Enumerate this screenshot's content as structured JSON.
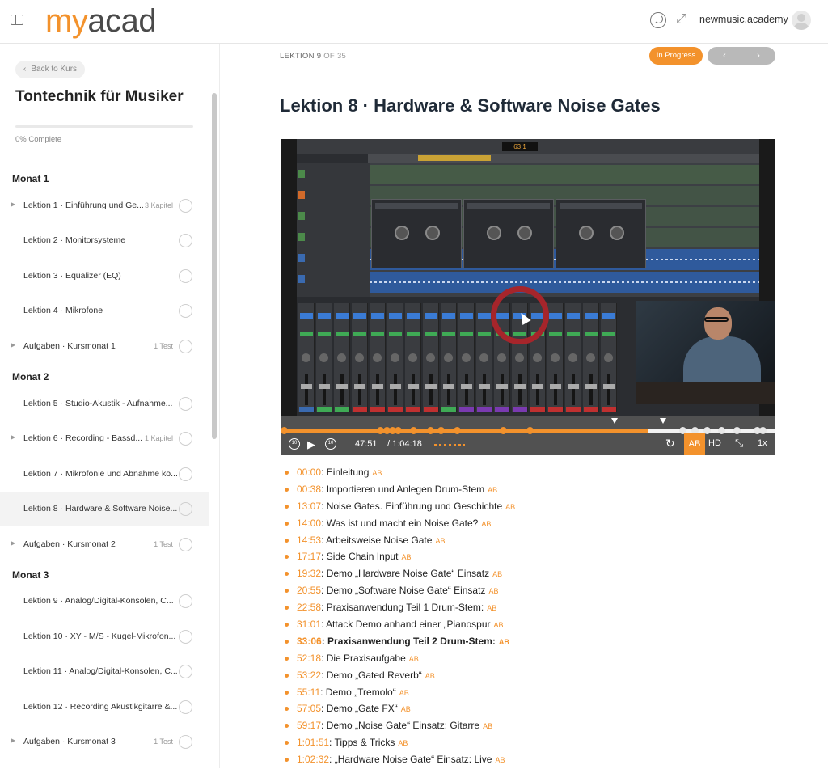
{
  "header": {
    "logo_my": "my",
    "logo_acad": "acad",
    "account": "newmusic.academy"
  },
  "sidebar": {
    "back_label": "Back to Kurs",
    "course_title": "Tontechnik für Musiker",
    "progress_text": "0% Complete",
    "progress_fraction": 0,
    "months": [
      "Monat 1",
      "Monat 2",
      "Monat 3"
    ],
    "items": [
      {
        "label": "Lektion 1 · Einführung und Ge...",
        "meta": "3 Kapitel"
      },
      {
        "label": "Lektion 2 · Monitorsysteme",
        "meta": ""
      },
      {
        "label": "Lektion 3 · Equalizer (EQ)",
        "meta": ""
      },
      {
        "label": "Lektion 4 · Mikrofone",
        "meta": ""
      },
      {
        "label": "Aufgaben · Kursmonat 1",
        "meta": "1 Test"
      },
      {
        "label": "Lektion 5 · Studio-Akustik - Aufnahme...",
        "meta": ""
      },
      {
        "label": "Lektion 6 · Recording - Bassd...",
        "meta": "1 Kapitel"
      },
      {
        "label": "Lektion 7 · Mikrofonie und Abnahme ko...",
        "meta": ""
      },
      {
        "label": "Lektion 8 · Hardware & Software Noise...",
        "meta": ""
      },
      {
        "label": "Aufgaben · Kursmonat 2",
        "meta": "1 Test"
      },
      {
        "label": "Lektion 9 · Analog/Digital-Konsolen, C...",
        "meta": ""
      },
      {
        "label": "Lektion 10 · XY - M/S - Kugel-Mikrofon...",
        "meta": ""
      },
      {
        "label": "Lektion 11 · Analog/Digital-Konsolen, C...",
        "meta": ""
      },
      {
        "label": "Lektion 12 · Recording Akustikgitarre &...",
        "meta": ""
      },
      {
        "label": "Aufgaben · Kursmonat 3",
        "meta": "1 Test"
      }
    ]
  },
  "main": {
    "lesson_count": "LEKTION 9",
    "lesson_of": "OF 35",
    "status": "In Progress",
    "prev": "‹",
    "next": "›",
    "title": "Lektion 8 · Hardware & Software Noise Gates"
  },
  "video": {
    "lcd": "63 1",
    "skip_back": "10",
    "skip_fwd": "10",
    "current_time": "47:51",
    "duration": "/ 1:04:18",
    "ab": "AB",
    "hd": "HD",
    "speed": "1x",
    "progress_fraction": 0.744
  },
  "chapters": [
    {
      "ts": "00:00",
      "text": ": Einleitung",
      "ab": "AB"
    },
    {
      "ts": "00:38",
      "text": ": Importieren und Anlegen Drum-Stem",
      "ab": "AB"
    },
    {
      "ts": "13:07",
      "text": ": Noise Gates. Einführung und Geschichte",
      "ab": "AB"
    },
    {
      "ts": "14:00",
      "text": ": Was ist und macht ein Noise Gate?",
      "ab": "AB"
    },
    {
      "ts": "14:53",
      "text": ": Arbeitsweise Noise Gate",
      "ab": "AB"
    },
    {
      "ts": "17:17",
      "text": ": Side Chain Input",
      "ab": "AB"
    },
    {
      "ts": "19:32",
      "text": ": Demo „Hardware Noise Gate“ Einsatz",
      "ab": "AB"
    },
    {
      "ts": "20:55",
      "text": ": Demo „Software Noise Gate“ Einsatz",
      "ab": "AB"
    },
    {
      "ts": "22:58",
      "text": ": Praxisanwendung Teil 1 Drum-Stem:",
      "ab": "AB"
    },
    {
      "ts": "31:01",
      "text": ": Attack Demo anhand einer „Pianospur",
      "ab": "AB"
    },
    {
      "ts": "33:06",
      "text": ": Praxisanwendung Teil 2 Drum-Stem:",
      "ab": "AB"
    },
    {
      "ts": "52:18",
      "text": ": Die Praxisaufgabe",
      "ab": "AB"
    },
    {
      "ts": "53:22",
      "text": ": Demo „Gated Reverb“",
      "ab": "AB"
    },
    {
      "ts": "55:11",
      "text": ": Demo „Tremolo“",
      "ab": "AB"
    },
    {
      "ts": "57:05",
      "text": ": Demo „Gate FX“",
      "ab": "AB"
    },
    {
      "ts": "59:17",
      "text": ": Demo „Noise Gate“ Einsatz: Gitarre",
      "ab": "AB"
    },
    {
      "ts": "1:01:51",
      "text": ": Tipps & Tricks",
      "ab": "AB"
    },
    {
      "ts": "1:02:32",
      "text": ": „Hardware Noise Gate“ Einsatz: Live",
      "ab": "AB"
    }
  ],
  "colors": {
    "accent": "#f3922c",
    "title": "#1f2a37",
    "ring": "#a6252b"
  }
}
